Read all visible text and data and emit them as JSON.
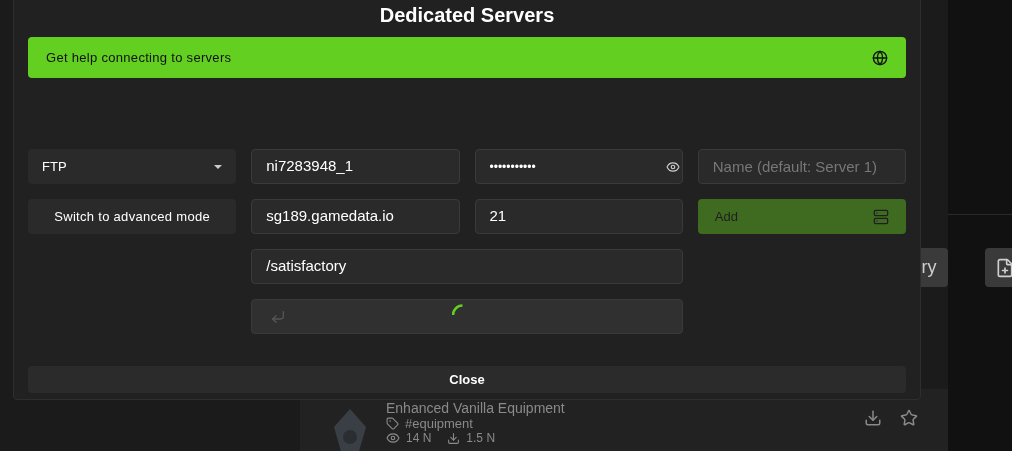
{
  "dialog": {
    "title": "Dedicated Servers",
    "help_banner": {
      "label": "Get help connecting to servers"
    },
    "protocol_select": {
      "value": "FTP"
    },
    "advanced_mode_button": {
      "label": "Switch to advanced mode"
    },
    "username": {
      "value": "ni7283948_1"
    },
    "password": {
      "value": "•••••••••••"
    },
    "name_field": {
      "placeholder": "Name (default: Server 1)"
    },
    "host": {
      "value": "sg189.gamedata.io"
    },
    "port": {
      "value": "21"
    },
    "add_button": {
      "label": "Add",
      "disabled": true
    },
    "path": {
      "value": "/satisfactory"
    },
    "connect_field": {
      "loading": true
    },
    "close_button": {
      "label": "Close"
    }
  },
  "background": {
    "toolbar_button": {
      "label": "ry"
    },
    "mod": {
      "title": "Enhanced Vanilla Equipment",
      "tag": "#equipment",
      "views": "14 N",
      "downloads": "1.5 N"
    }
  }
}
